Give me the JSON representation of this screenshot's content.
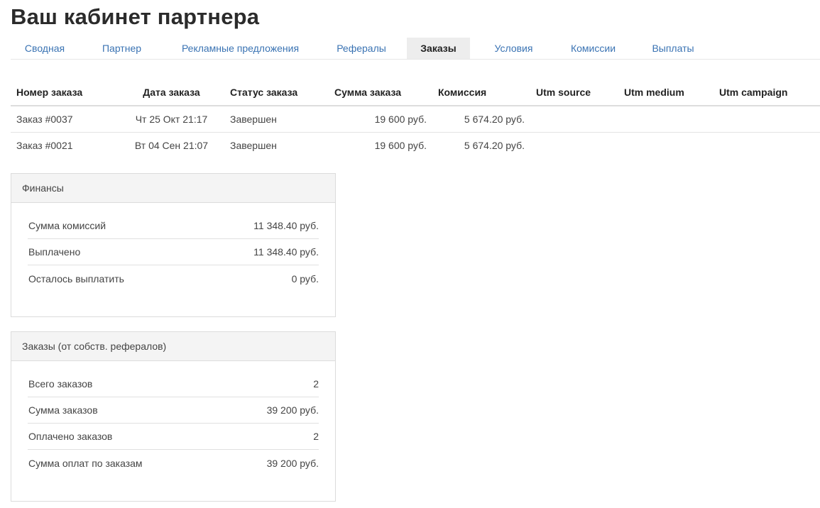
{
  "page": {
    "title": "Ваш кабинет партнера"
  },
  "tabs": [
    {
      "label": "Сводная",
      "active": false
    },
    {
      "label": "Партнер",
      "active": false
    },
    {
      "label": "Рекламные предложения",
      "active": false
    },
    {
      "label": "Рефералы",
      "active": false
    },
    {
      "label": "Заказы",
      "active": true
    },
    {
      "label": "Условия",
      "active": false
    },
    {
      "label": "Комиссии",
      "active": false
    },
    {
      "label": "Выплаты",
      "active": false
    }
  ],
  "orders": {
    "columns": [
      "Номер заказа",
      "Дата заказа",
      "Статус заказа",
      "Сумма заказа",
      "Комиссия",
      "Utm source",
      "Utm medium",
      "Utm campaign"
    ],
    "rows": [
      {
        "number": "Заказ #0037",
        "date": "Чт 25 Окт 21:17",
        "status": "Завершен",
        "sum": "19 600 руб.",
        "commission": "5 674.20 руб.",
        "utm_source": "",
        "utm_medium": "",
        "utm_campaign": ""
      },
      {
        "number": "Заказ #0021",
        "date": "Вт 04 Сен 21:07",
        "status": "Завершен",
        "sum": "19 600 руб.",
        "commission": "5 674.20 руб.",
        "utm_source": "",
        "utm_medium": "",
        "utm_campaign": ""
      }
    ]
  },
  "finances": {
    "title": "Финансы",
    "rows": [
      {
        "label": "Сумма комиссий",
        "value": "11 348.40 руб."
      },
      {
        "label": "Выплачено",
        "value": "11 348.40 руб."
      },
      {
        "label": "Осталось выплатить",
        "value": "0 руб."
      }
    ]
  },
  "orders_summary": {
    "title": "Заказы (от собств. рефералов)",
    "rows": [
      {
        "label": "Всего заказов",
        "value": "2"
      },
      {
        "label": "Сумма заказов",
        "value": "39 200 руб."
      },
      {
        "label": "Оплачено заказов",
        "value": "2"
      },
      {
        "label": "Сумма оплат по заказам",
        "value": "39 200 руб."
      }
    ]
  }
}
